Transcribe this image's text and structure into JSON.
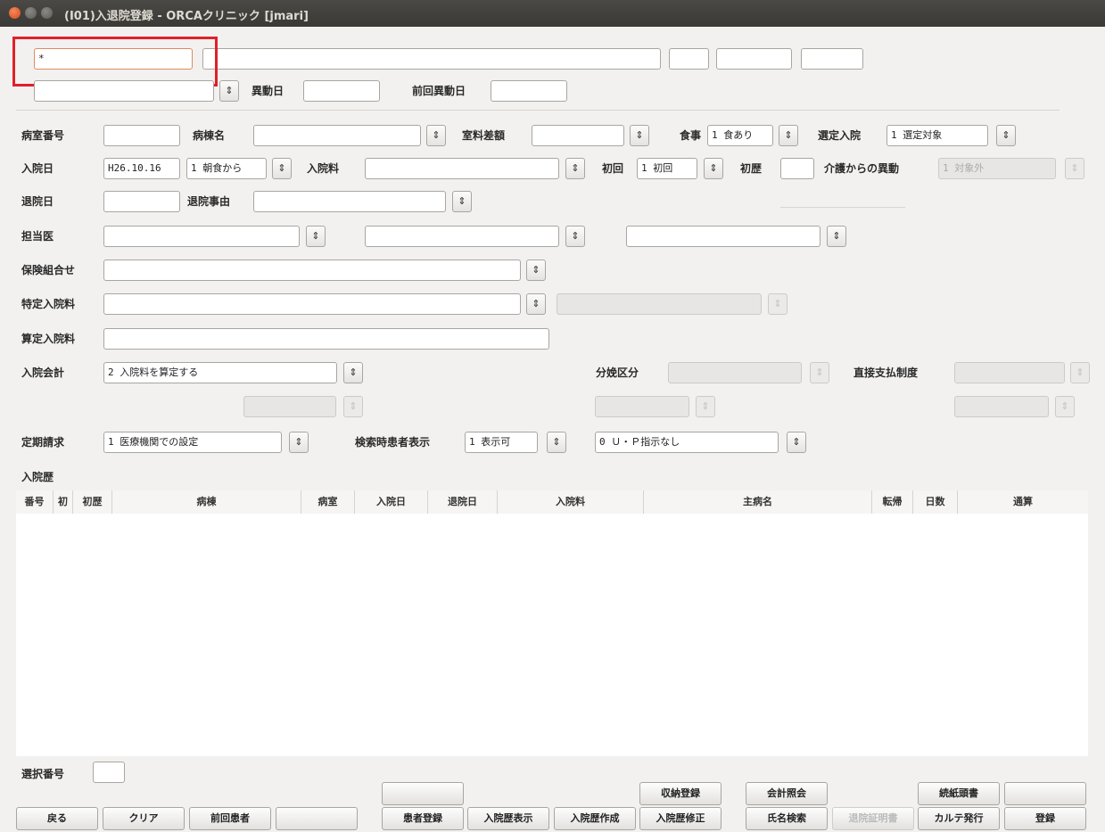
{
  "window": {
    "title": "(I01)入退院登録 - ORCAクリニック [jmari]"
  },
  "top": {
    "patient_id_value": "*",
    "ido_label": "異動日",
    "prev_ido_label": "前回異動日"
  },
  "form": {
    "room_no_label": "病室番号",
    "ward_label": "病棟名",
    "room_diff_label": "室料差額",
    "meal_label": "食事",
    "meal_value": "1 食あり",
    "selected_label": "選定入院",
    "selected_value": "1 選定対象",
    "admit_date_label": "入院日",
    "admit_date_value": "H26.10.16",
    "admit_meal_value": "1 朝食から",
    "admit_fee_label": "入院料",
    "first_label": "初回",
    "first_value": "1 初回",
    "history_label": "初歴",
    "care_label": "介護からの異動",
    "care_value": "1 対象外",
    "discharge_date_label": "退院日",
    "discharge_reason_label": "退院事由",
    "doctor_label": "担当医",
    "insurance_label": "保険組合せ",
    "special_fee_label": "特定入院料",
    "calc_fee_label": "算定入院料",
    "accounting_label": "入院会計",
    "accounting_value": "2 入院料を算定する",
    "delivery_label": "分娩区分",
    "direct_pay_label": "直接支払制度",
    "periodic_label": "定期請求",
    "periodic_value": "1 医療機関での設定",
    "search_display_label": "検索時患者表示",
    "search_display_value": "1 表示可",
    "up_value": "0 Ｕ・Ｐ指示なし"
  },
  "history": {
    "title": "入院歴",
    "columns": [
      "番号",
      "初",
      "初歴",
      "病棟",
      "病室",
      "入院日",
      "退院日",
      "入院料",
      "主病名",
      "転帰",
      "日数",
      "通算"
    ],
    "rows": []
  },
  "bottom": {
    "select_no_label": "選択番号",
    "buttons_top": {
      "shuno": "収納登録",
      "kaikei": "会計照会",
      "zokushi": "続紙頭書"
    },
    "buttons": {
      "back": "戻る",
      "clear": "クリア",
      "prev_patient": "前回患者",
      "patient_reg": "患者登録",
      "history_show": "入院歴表示",
      "history_create": "入院歴作成",
      "history_edit": "入院歴修正",
      "name_search": "氏名検索",
      "discharge_cert": "退院証明書",
      "karte": "カルテ発行",
      "register": "登録"
    }
  },
  "colors": {
    "highlight": "#e0202a",
    "titlebar": "#3c3b37"
  }
}
